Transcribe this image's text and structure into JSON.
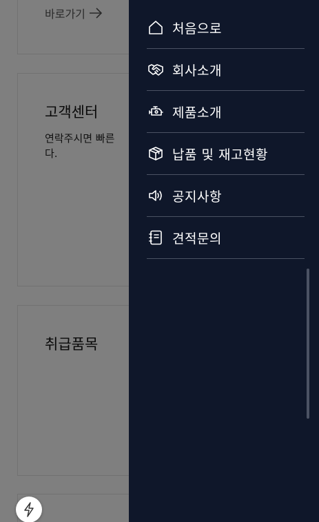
{
  "background": {
    "shortcut_label": "바로가기",
    "customer_center": {
      "title": "고객센터",
      "description": "연락주시면 빠른\n다."
    },
    "products": {
      "title": "취급품목"
    },
    "float_button_icon": "lightning-icon"
  },
  "drawer": {
    "background_color": "#0f172a",
    "divider_color": "#4b5263",
    "items": [
      {
        "label": "처음으로",
        "icon": "home-icon"
      },
      {
        "label": "회사소개",
        "icon": "handshake-icon"
      },
      {
        "label": "제품소개",
        "icon": "engine-icon"
      },
      {
        "label": "납품 및 재고현황",
        "icon": "box-icon"
      },
      {
        "label": "공지사항",
        "icon": "speaker-icon"
      },
      {
        "label": "견적문의",
        "icon": "notebook-icon"
      }
    ]
  }
}
